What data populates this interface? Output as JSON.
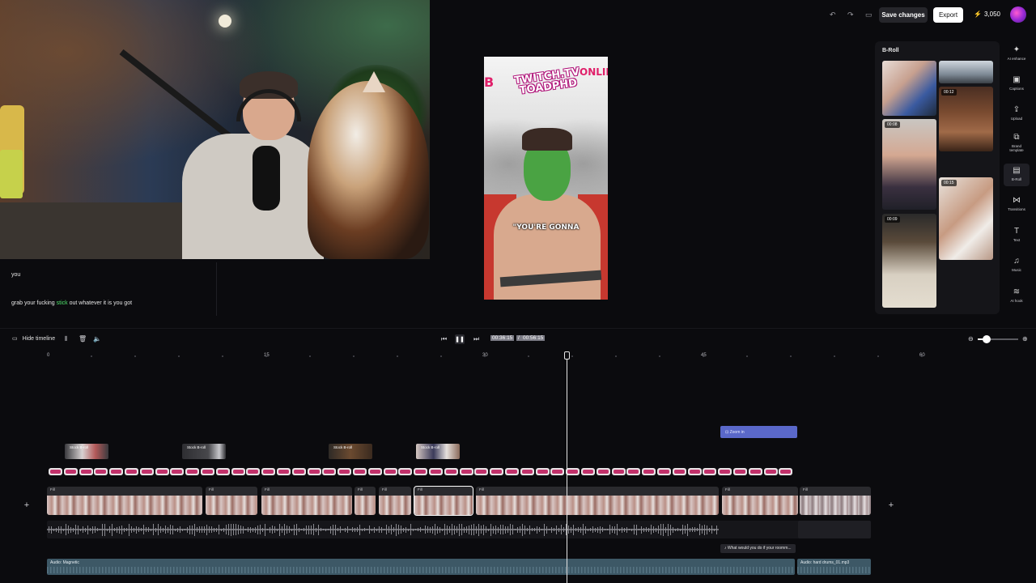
{
  "transcript": {
    "line1": "you",
    "line2_before": "grab your fucking ",
    "line2_highlight": "stick",
    "line2_after": " out whatever it is you got"
  },
  "preview": {
    "brand_line1": "TWITCH.TV",
    "brand_line2": "TOADPHD",
    "brand_right": "ONLIN",
    "brand_left": "B",
    "caption": "\"YOU'RE GONNA"
  },
  "topbar": {
    "undo_icon": "undo-icon",
    "redo_icon": "redo-icon",
    "aspect_icon": "aspect-ratio-icon",
    "save_label": "Save changes",
    "export_label": "Export",
    "credits": "3,050",
    "credits_icon": "lightning-icon"
  },
  "broll": {
    "title": "B-Roll",
    "items": [
      {
        "duration": ""
      },
      {
        "duration": ""
      },
      {
        "duration": "00:12"
      },
      {
        "duration": "00:08"
      },
      {
        "duration": "00:15"
      },
      {
        "duration": "00:09"
      }
    ]
  },
  "sidebar": {
    "items": [
      {
        "icon": "sparkle-icon",
        "label": "AI enhance"
      },
      {
        "icon": "captions-icon",
        "label": "Captions"
      },
      {
        "icon": "upload-icon",
        "label": "Upload"
      },
      {
        "icon": "brand-template-icon",
        "label": "Brand template"
      },
      {
        "icon": "broll-icon",
        "label": "B-Roll"
      },
      {
        "icon": "transitions-icon",
        "label": "Transitions"
      },
      {
        "icon": "text-icon",
        "label": "Text"
      },
      {
        "icon": "music-icon",
        "label": "Music"
      },
      {
        "icon": "ai-hook-icon",
        "label": "AI hook"
      }
    ]
  },
  "timeline": {
    "hide_label": "Hide timeline",
    "current_time": "00:36:15",
    "separator": "/",
    "total_time": "00:56:15",
    "ruler": [
      "0",
      "15",
      "30",
      "45",
      "60"
    ],
    "zoom_clip": "Zoom in",
    "stock_label": "Stock B-roll",
    "segment_label": "Fill",
    "music_label": "What would you do if your roomm...",
    "audio1": "Audio: Magnetic",
    "audio2": "Audio: hard drums_01.mp3",
    "zoom_level": 0.2
  },
  "colors": {
    "accent_green": "#4fe06b",
    "zoom_clip": "#5a68c9",
    "audio_track": "#3d5866",
    "credit_bolt": "#f2c038"
  }
}
